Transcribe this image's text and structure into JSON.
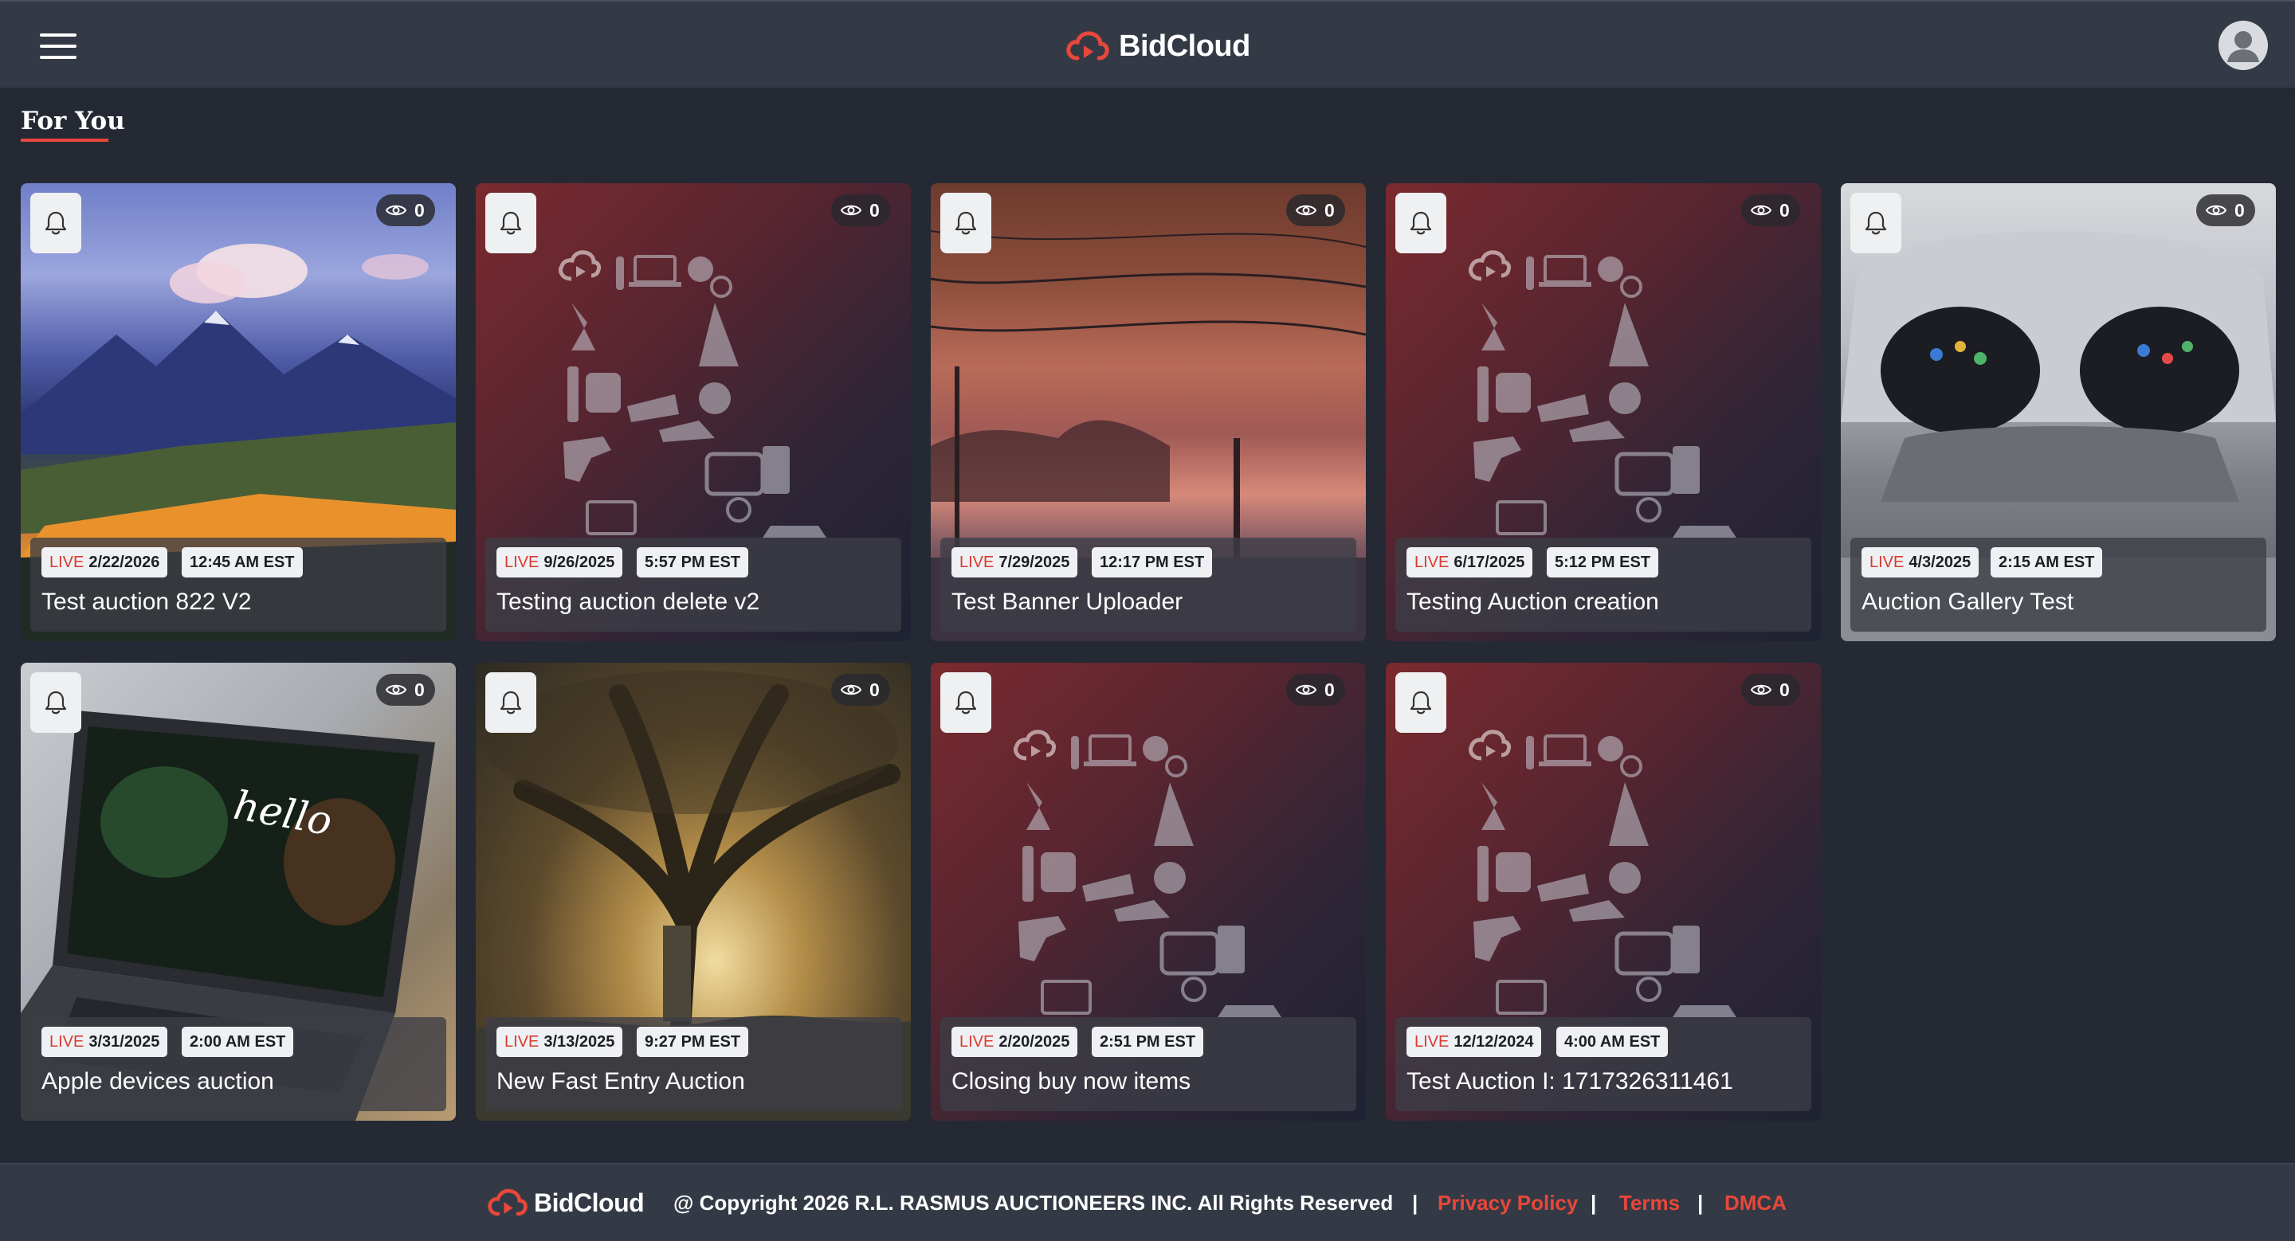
{
  "header": {
    "menu_icon": "hamburger-menu-icon",
    "brand_name": "BidCloud",
    "brand_color": "#e8473a",
    "avatar_icon": "user-avatar-icon"
  },
  "section": {
    "title": "For You",
    "accent": "#e8473a"
  },
  "auctions": [
    {
      "title": "Test auction 822 V2",
      "live_label": "LIVE",
      "date": "2/22/2026",
      "time": "12:45 AM EST",
      "views": "0",
      "image": "mountain-landscape"
    },
    {
      "title": "Testing auction delete v2",
      "live_label": "LIVE",
      "date": "9/26/2025",
      "time": "5:57 PM EST",
      "views": "0",
      "image": "bidcloud-placeholder"
    },
    {
      "title": "Test Banner Uploader",
      "live_label": "LIVE",
      "date": "7/29/2025",
      "time": "12:17 PM EST",
      "views": "0",
      "image": "sunset-power-lines"
    },
    {
      "title": "Testing Auction creation",
      "live_label": "LIVE",
      "date": "6/17/2025",
      "time": "5:12 PM EST",
      "views": "0",
      "image": "bidcloud-placeholder"
    },
    {
      "title": "Auction Gallery Test",
      "live_label": "LIVE",
      "date": "4/3/2025",
      "time": "2:15 AM EST",
      "views": "0",
      "image": "vr-headset"
    },
    {
      "title": "Apple devices auction",
      "live_label": "LIVE",
      "date": "3/31/2025",
      "time": "2:00 AM EST",
      "views": "0",
      "image": "laptop-hello"
    },
    {
      "title": "New Fast Entry Auction",
      "live_label": "LIVE",
      "date": "3/13/2025",
      "time": "9:27 PM EST",
      "views": "0",
      "image": "fantasy-tree"
    },
    {
      "title": "Closing buy now items",
      "live_label": "LIVE",
      "date": "2/20/2025",
      "time": "2:51 PM EST",
      "views": "0",
      "image": "bidcloud-placeholder"
    },
    {
      "title": "Test Auction I: 1717326311461",
      "live_label": "LIVE",
      "date": "12/12/2024",
      "time": "4:00 AM EST",
      "views": "0",
      "image": "bidcloud-placeholder"
    }
  ],
  "footer": {
    "brand_name": "BidCloud",
    "copyright": "@ Copyright 2026 R.L. RASMUS AUCTIONEERS INC. All Rights Reserved",
    "separator": "|",
    "links": [
      "Privacy Policy",
      "Terms",
      "DMCA"
    ],
    "link_color": "#e8473a"
  }
}
